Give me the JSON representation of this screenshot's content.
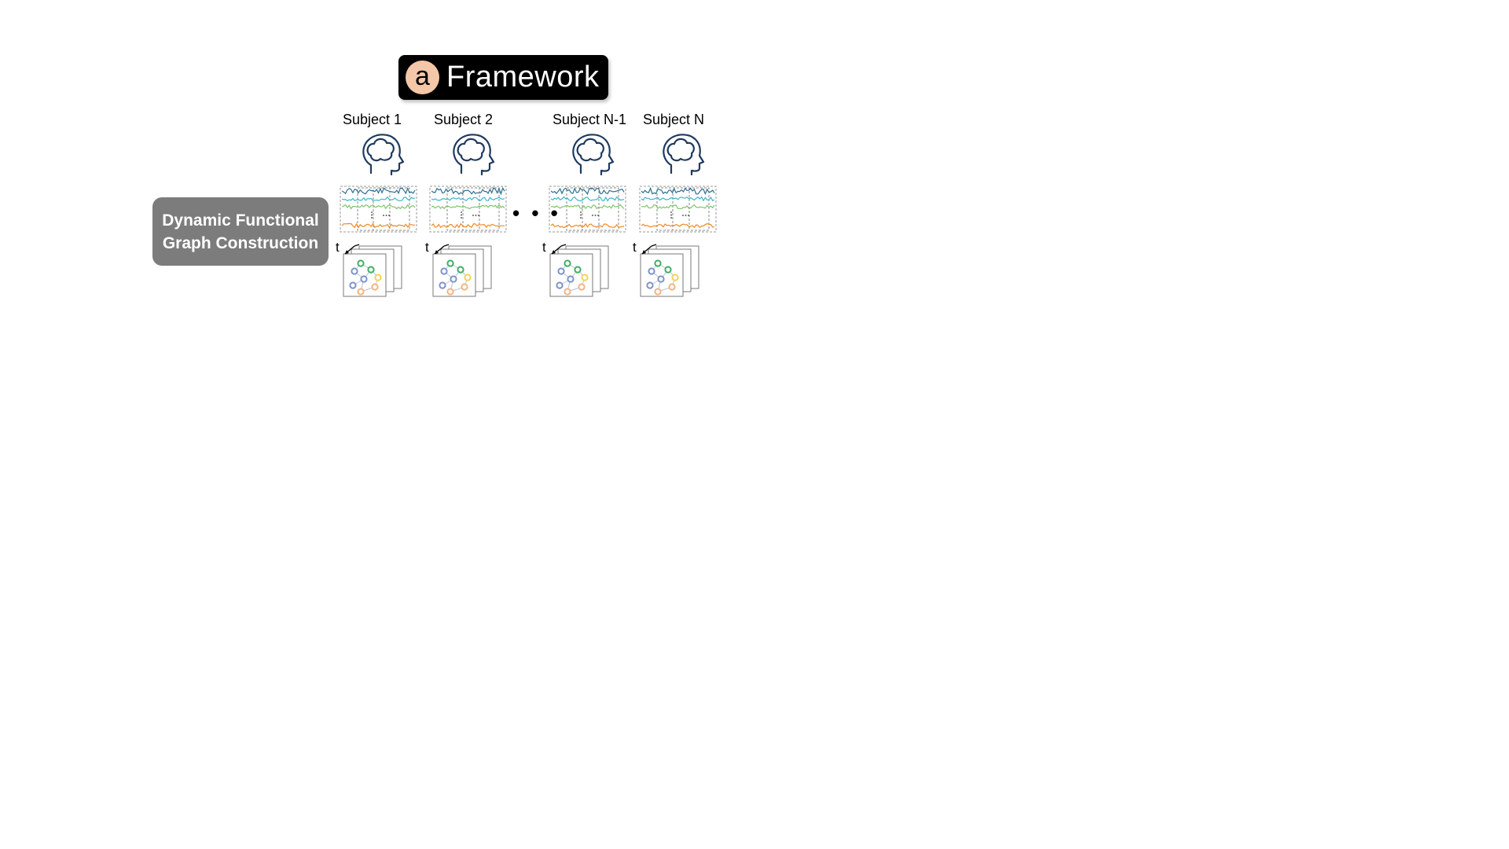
{
  "header": {
    "badge_letter": "a",
    "title": "Framework"
  },
  "stage": {
    "line1": "Dynamic Functional",
    "line2": "Graph Construction"
  },
  "subjects": [
    {
      "label": "Subject 1"
    },
    {
      "label": "Subject 2"
    },
    {
      "label": "Subject N-1"
    },
    {
      "label": "Subject N"
    }
  ],
  "ellipsis": "• • •",
  "time_axis_label": "t",
  "colors": {
    "signal_1": "#2f6f8f",
    "signal_2": "#3fb6c8",
    "signal_3": "#7cc66a",
    "signal_4": "#f08a24",
    "node_green": "#3fae63",
    "node_yellow": "#f2d35a",
    "node_blue": "#7d93c9",
    "node_orange": "#f4b483"
  }
}
